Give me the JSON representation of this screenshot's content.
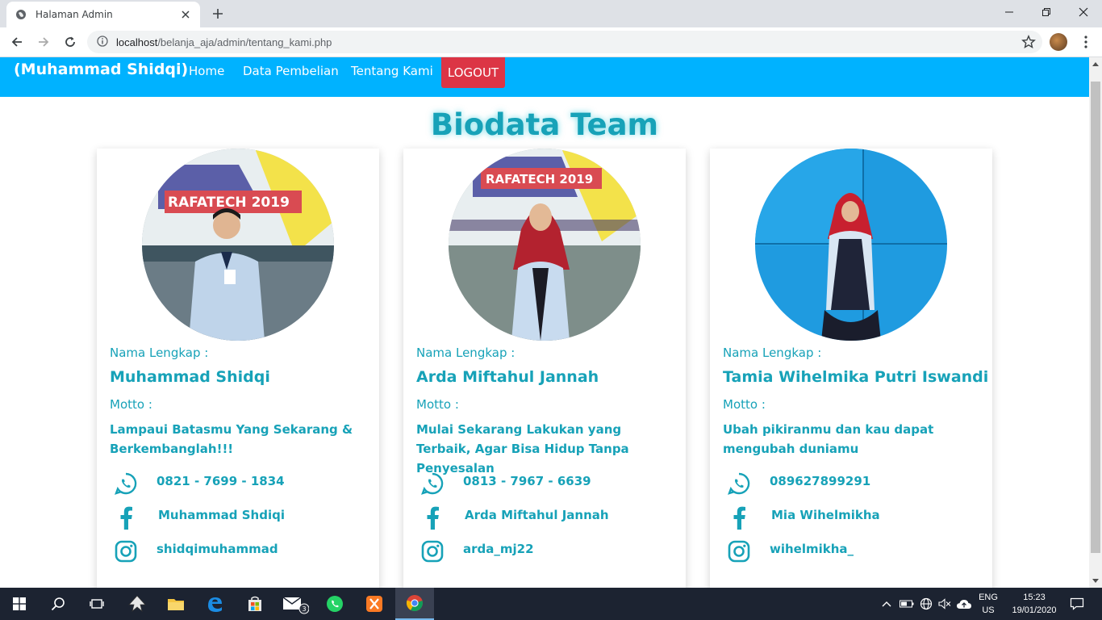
{
  "browser": {
    "tab_title": "Halaman Admin",
    "url_host": "localhost",
    "url_path": "/belanja_aja/admin/tentang_kami.php"
  },
  "navbar": {
    "brand": "(Muhammad Shidqi)",
    "links": [
      "Home",
      "Data Pembelian",
      "Tentang Kami"
    ],
    "logout": "LOGOUT",
    "color": "#00b2ff",
    "logout_color": "#dc3545"
  },
  "page": {
    "title": "Biodata Team",
    "accent_color": "#17a2b8"
  },
  "members": [
    {
      "name_label": "Nama Lengkap :",
      "name": "Muhammad Shidqi",
      "motto_label": "Motto :",
      "motto": "Lampaui Batasmu Yang Sekarang & Berkembanglah!!!",
      "phone": "0821 - 7699 - 1834",
      "facebook": "Muhammad Shdiqi",
      "instagram": "shidqimuhammad"
    },
    {
      "name_label": "Nama Lengkap :",
      "name": "Arda Miftahul Jannah",
      "motto_label": "Motto :",
      "motto": "Mulai Sekarang Lakukan yang Terbaik, Agar Bisa Hidup Tanpa Penyesalan",
      "phone": "0813 - 7967 - 6639",
      "facebook": "Arda Miftahul Jannah",
      "instagram": "arda_mj22"
    },
    {
      "name_label": "Nama Lengkap :",
      "name": "Tamia Wihelmika Putri Iswandi",
      "motto_label": "Motto :",
      "motto": "Ubah pikiranmu dan kau dapat mengubah duniamu",
      "phone": "089627899291",
      "facebook": "Mia Wihelmikha",
      "instagram": "wihelmikha_"
    }
  ],
  "taskbar": {
    "mail_badge": "3",
    "lang_line1": "ENG",
    "lang_line2": "US",
    "time": "15:23",
    "date": "19/01/2020"
  }
}
